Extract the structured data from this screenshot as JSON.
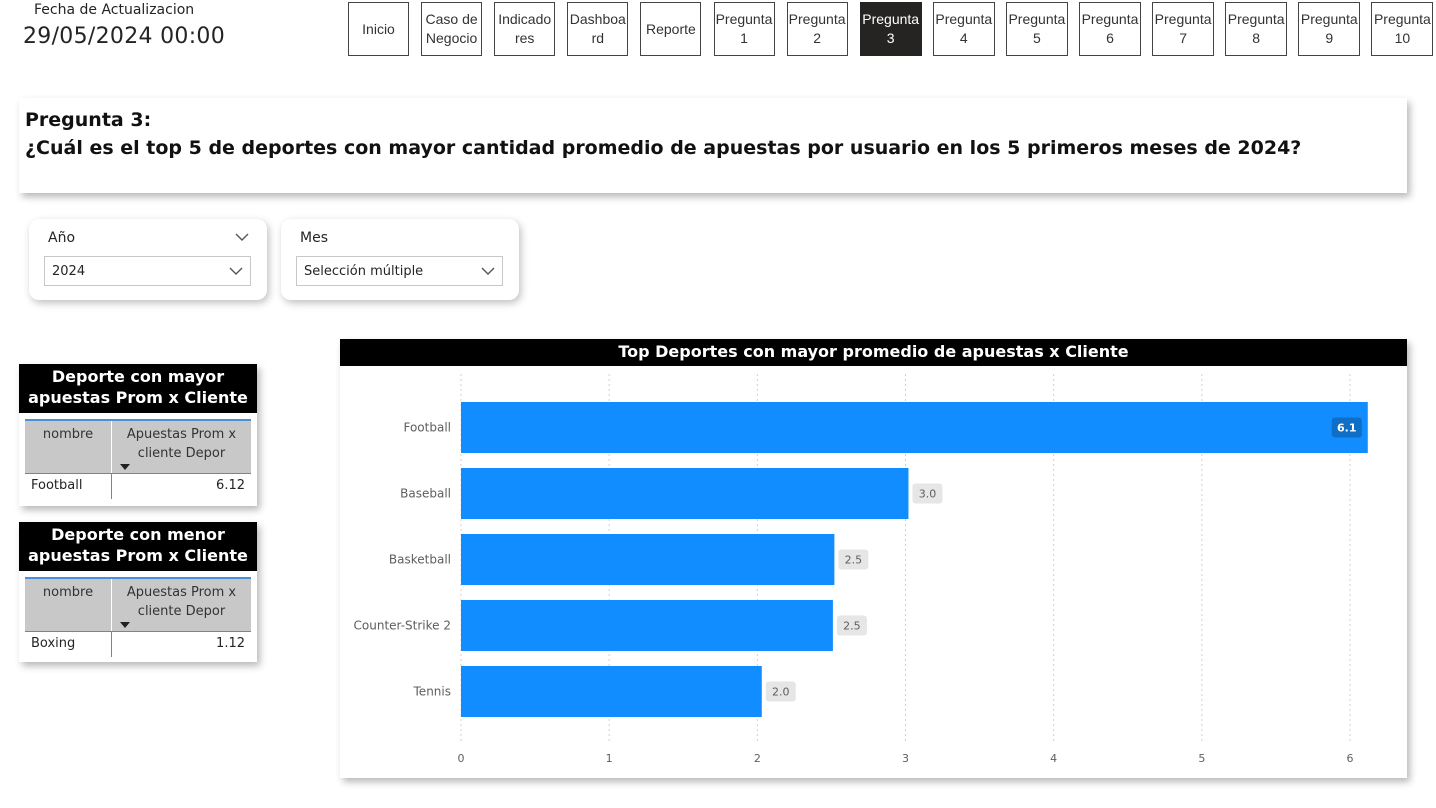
{
  "header": {
    "update_label": "Fecha de Actualizacion",
    "update_value": "29/05/2024 00:00"
  },
  "nav": [
    {
      "label": "Inicio",
      "active": false
    },
    {
      "label": "Caso de\nNegocio",
      "active": false
    },
    {
      "label": "Indicado\nres",
      "active": false
    },
    {
      "label": "Dashboa\nrd",
      "active": false
    },
    {
      "label": "Reporte",
      "active": false
    },
    {
      "label": "Pregunta\n1",
      "active": false
    },
    {
      "label": "Pregunta\n2",
      "active": false
    },
    {
      "label": "Pregunta\n3",
      "active": true
    },
    {
      "label": "Pregunta\n4",
      "active": false
    },
    {
      "label": "Pregunta\n5",
      "active": false
    },
    {
      "label": "Pregunta\n6",
      "active": false
    },
    {
      "label": "Pregunta\n7",
      "active": false
    },
    {
      "label": "Pregunta\n8",
      "active": false
    },
    {
      "label": "Pregunta\n9",
      "active": false
    },
    {
      "label": "Pregunta\n10",
      "active": false
    }
  ],
  "question": {
    "title": "Pregunta 3:",
    "text": "¿Cuál es el top 5 de deportes con mayor cantidad promedio de apuestas por usuario en los 5 primeros meses de 2024?"
  },
  "slicers": {
    "year": {
      "title": "Año",
      "value": "2024"
    },
    "month": {
      "title": "Mes",
      "value": "Selección múltiple"
    }
  },
  "table_max": {
    "title": "Deporte con mayor apuestas Prom x Cliente",
    "col1": "nombre",
    "col2": "Apuestas Prom x cliente Depor",
    "row": {
      "nombre": "Football",
      "value": "6.12"
    }
  },
  "table_min": {
    "title": "Deporte con menor apuestas Prom x Cliente",
    "col1": "nombre",
    "col2": "Apuestas Prom x cliente Depor",
    "row": {
      "nombre": "Boxing",
      "value": "1.12"
    }
  },
  "colors": {
    "bar": "#118DFF",
    "label_bg": "#E6E6E6",
    "inside_label_bg": "#0F6EC6"
  },
  "chart_data": {
    "type": "bar",
    "orientation": "horizontal",
    "title": "Top Deportes con mayor promedio de apuestas x Cliente",
    "categories": [
      "Football",
      "Baseball",
      "Basketball",
      "Counter-Strike 2",
      "Tennis"
    ],
    "values": [
      6.12,
      3.02,
      2.52,
      2.51,
      2.03
    ],
    "data_labels": [
      "6.1",
      "3.0",
      "2.5",
      "2.5",
      "2.0"
    ],
    "xlim": [
      0,
      6.12
    ],
    "xticks": [
      0,
      1,
      2,
      3,
      4,
      5,
      6
    ],
    "grid": true
  }
}
